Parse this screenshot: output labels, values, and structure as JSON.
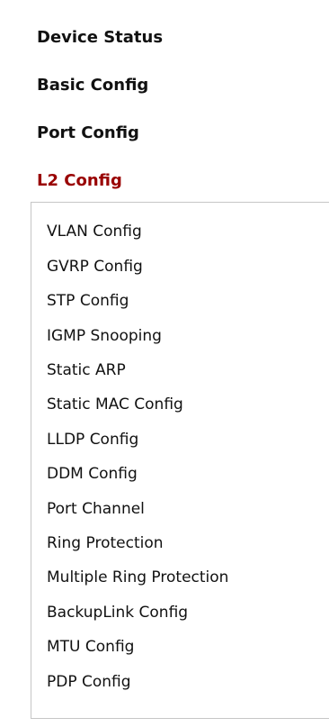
{
  "nav": {
    "top_items": [
      {
        "label": "Device Status"
      },
      {
        "label": "Basic Config"
      },
      {
        "label": "Port Config"
      },
      {
        "label": "L2 Config",
        "active": true
      }
    ],
    "sub_items": [
      {
        "label": "VLAN Config"
      },
      {
        "label": "GVRP Config"
      },
      {
        "label": "STP Config"
      },
      {
        "label": "IGMP Snooping"
      },
      {
        "label": "Static ARP"
      },
      {
        "label": "Static MAC Config"
      },
      {
        "label": "LLDP Config"
      },
      {
        "label": "DDM Config"
      },
      {
        "label": "Port Channel"
      },
      {
        "label": "Ring Protection"
      },
      {
        "label": "Multiple Ring Protection"
      },
      {
        "label": "BackupLink Config"
      },
      {
        "label": "MTU Config"
      },
      {
        "label": "PDP Config"
      }
    ]
  },
  "colors": {
    "active": "#990000",
    "text": "#111111",
    "border": "#c6c6c6"
  }
}
